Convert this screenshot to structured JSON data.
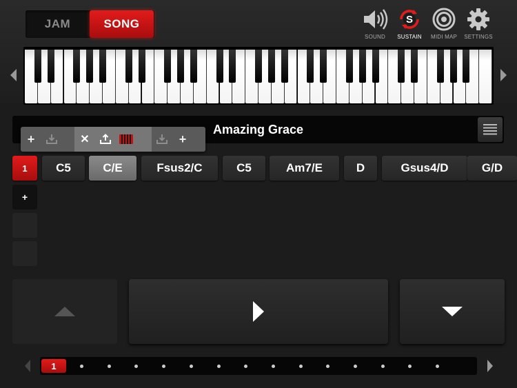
{
  "modes": {
    "jam": "JAM",
    "song": "SONG",
    "active": "SONG"
  },
  "top_icons": [
    {
      "name": "speaker-icon",
      "label": "SOUND"
    },
    {
      "name": "sustain-icon",
      "label": "SUSTAIN",
      "glyph": "S"
    },
    {
      "name": "target-icon",
      "label": "MIDI MAP"
    },
    {
      "name": "gear-icon",
      "label": "SETTINGS"
    }
  ],
  "song": {
    "title": "Amazing Grace"
  },
  "chords": {
    "section_number": "1",
    "items": [
      "C5",
      "C/E",
      "Fsus2/C",
      "C5",
      "Am7/E",
      "D",
      "Gsus4/D",
      "G/D"
    ],
    "selected_index": 1
  },
  "add_section_label": "+",
  "edit_toolbar": {
    "add_left": "+",
    "delete": "✕",
    "add_right": "+"
  },
  "pager": {
    "current_page": "1",
    "dot_count": 14
  },
  "colors": {
    "accent": "#d01616",
    "background": "#1c1c1c"
  }
}
